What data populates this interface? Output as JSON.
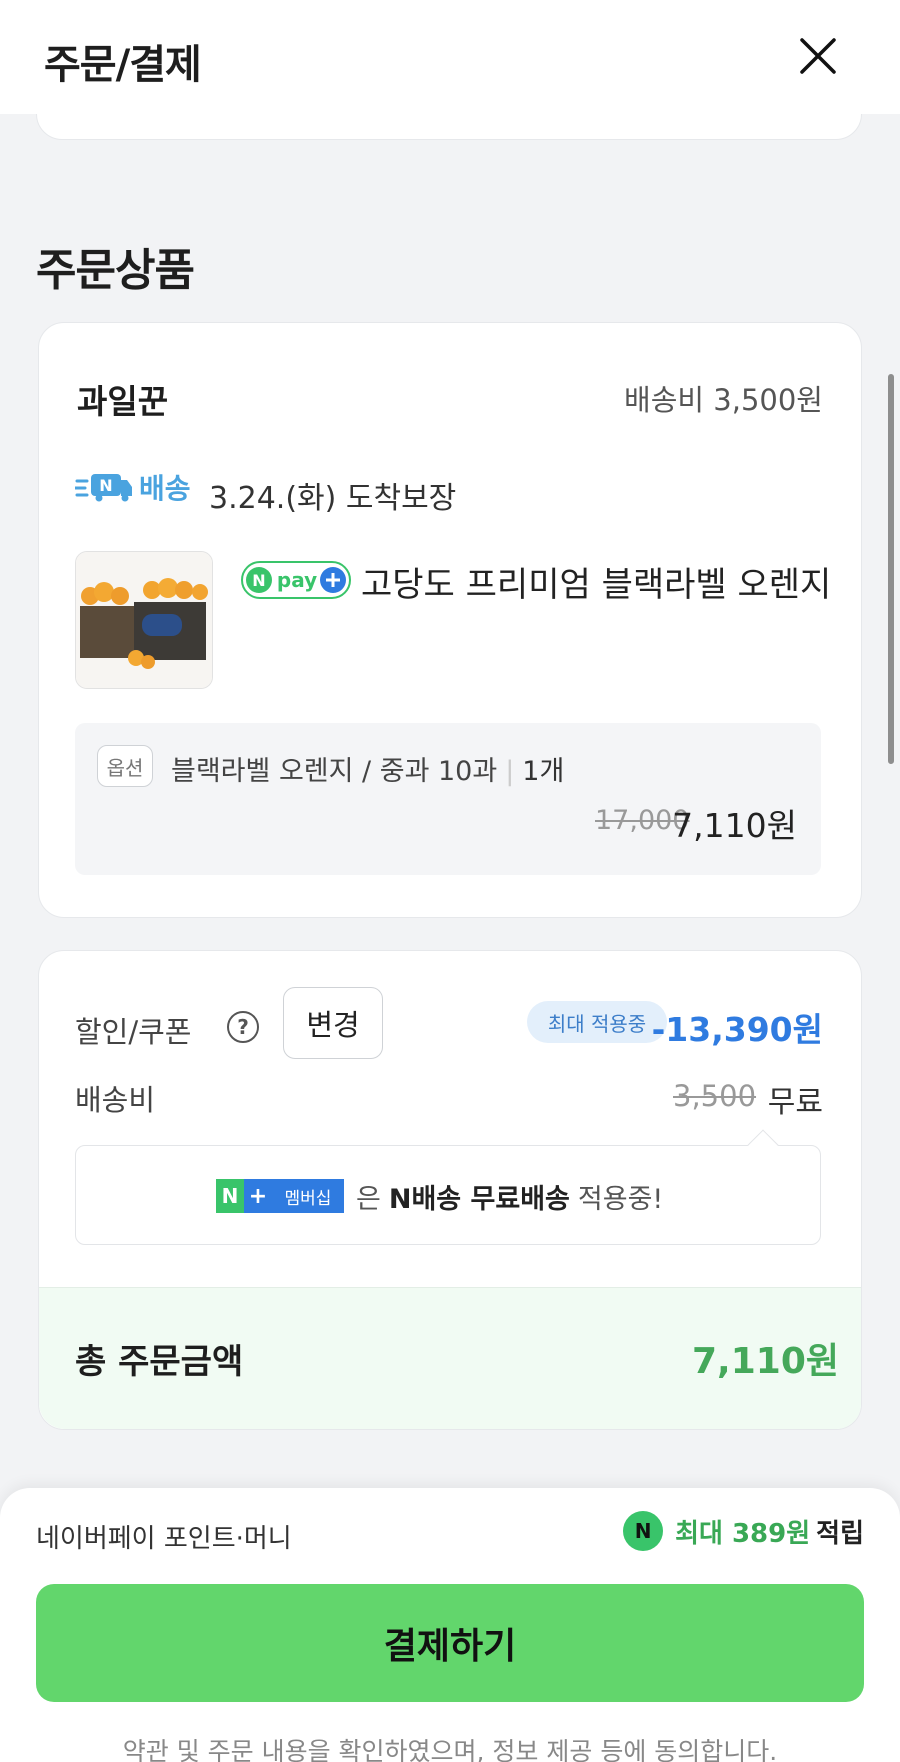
{
  "header": {
    "title": "주문/결제",
    "close_icon": "close-icon"
  },
  "section": {
    "title": "주문상품"
  },
  "store": {
    "name": "과일꾼",
    "shipping_fee": "배송비 3,500원",
    "delivery_badge": "배송",
    "arrival": "3.24.(화) 도착보장"
  },
  "product": {
    "npay_badge": "pay",
    "name": "고당도 프리미엄 블랙라벨 오렌지",
    "option_tag": "옵션",
    "option": "블랙라벨 오렌지 / 중과 10과",
    "quantity": "1개",
    "original_price": "17,000",
    "price": "7,110원"
  },
  "summary": {
    "discount_label": "할인/쿠폰",
    "change_label": "변경",
    "max_applied": "최대 적용중",
    "discount": "-13,390원",
    "shipping_label": "배송비",
    "shipping_original": "3,500",
    "shipping_free": "무료",
    "membership_badge_text": "멤버십",
    "membership_prefix": "은",
    "membership_bold": "N배송 무료배송",
    "membership_suffix": "적용중!",
    "total_label": "총 주문금액",
    "total_value": "7,110원"
  },
  "footer": {
    "points_label": "네이버페이 포인트·머니",
    "points_max": "최대 389원",
    "points_suffix": "적립",
    "pay_button": "결제하기",
    "agreement": "약관 및 주문 내용을 확인하였으며, 정보 제공 등에 동의합니다."
  },
  "colors": {
    "accent_green": "#62d66c",
    "total_green": "#45a85a",
    "discount_blue": "#2f7be0"
  }
}
